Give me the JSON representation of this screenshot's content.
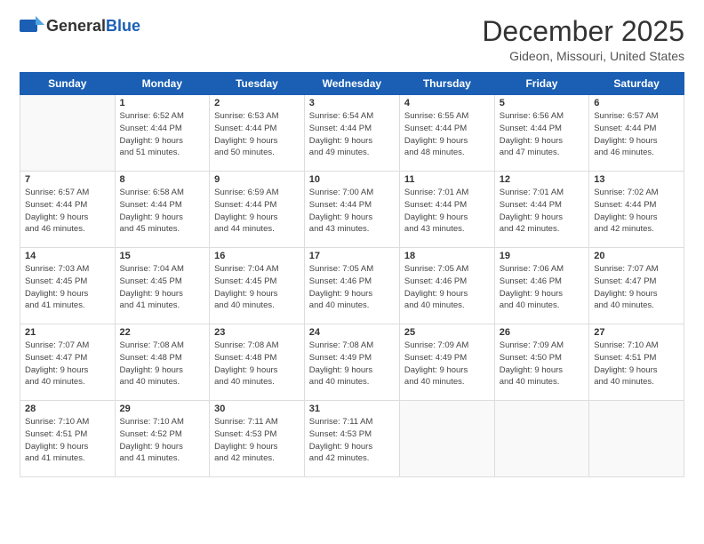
{
  "header": {
    "logo_general": "General",
    "logo_blue": "Blue",
    "title": "December 2025",
    "subtitle": "Gideon, Missouri, United States"
  },
  "weekdays": [
    "Sunday",
    "Monday",
    "Tuesday",
    "Wednesday",
    "Thursday",
    "Friday",
    "Saturday"
  ],
  "weeks": [
    [
      {
        "day": "",
        "info": ""
      },
      {
        "day": "1",
        "info": "Sunrise: 6:52 AM\nSunset: 4:44 PM\nDaylight: 9 hours\nand 51 minutes."
      },
      {
        "day": "2",
        "info": "Sunrise: 6:53 AM\nSunset: 4:44 PM\nDaylight: 9 hours\nand 50 minutes."
      },
      {
        "day": "3",
        "info": "Sunrise: 6:54 AM\nSunset: 4:44 PM\nDaylight: 9 hours\nand 49 minutes."
      },
      {
        "day": "4",
        "info": "Sunrise: 6:55 AM\nSunset: 4:44 PM\nDaylight: 9 hours\nand 48 minutes."
      },
      {
        "day": "5",
        "info": "Sunrise: 6:56 AM\nSunset: 4:44 PM\nDaylight: 9 hours\nand 47 minutes."
      },
      {
        "day": "6",
        "info": "Sunrise: 6:57 AM\nSunset: 4:44 PM\nDaylight: 9 hours\nand 46 minutes."
      }
    ],
    [
      {
        "day": "7",
        "info": "Sunrise: 6:57 AM\nSunset: 4:44 PM\nDaylight: 9 hours\nand 46 minutes."
      },
      {
        "day": "8",
        "info": "Sunrise: 6:58 AM\nSunset: 4:44 PM\nDaylight: 9 hours\nand 45 minutes."
      },
      {
        "day": "9",
        "info": "Sunrise: 6:59 AM\nSunset: 4:44 PM\nDaylight: 9 hours\nand 44 minutes."
      },
      {
        "day": "10",
        "info": "Sunrise: 7:00 AM\nSunset: 4:44 PM\nDaylight: 9 hours\nand 43 minutes."
      },
      {
        "day": "11",
        "info": "Sunrise: 7:01 AM\nSunset: 4:44 PM\nDaylight: 9 hours\nand 43 minutes."
      },
      {
        "day": "12",
        "info": "Sunrise: 7:01 AM\nSunset: 4:44 PM\nDaylight: 9 hours\nand 42 minutes."
      },
      {
        "day": "13",
        "info": "Sunrise: 7:02 AM\nSunset: 4:44 PM\nDaylight: 9 hours\nand 42 minutes."
      }
    ],
    [
      {
        "day": "14",
        "info": "Sunrise: 7:03 AM\nSunset: 4:45 PM\nDaylight: 9 hours\nand 41 minutes."
      },
      {
        "day": "15",
        "info": "Sunrise: 7:04 AM\nSunset: 4:45 PM\nDaylight: 9 hours\nand 41 minutes."
      },
      {
        "day": "16",
        "info": "Sunrise: 7:04 AM\nSunset: 4:45 PM\nDaylight: 9 hours\nand 40 minutes."
      },
      {
        "day": "17",
        "info": "Sunrise: 7:05 AM\nSunset: 4:46 PM\nDaylight: 9 hours\nand 40 minutes."
      },
      {
        "day": "18",
        "info": "Sunrise: 7:05 AM\nSunset: 4:46 PM\nDaylight: 9 hours\nand 40 minutes."
      },
      {
        "day": "19",
        "info": "Sunrise: 7:06 AM\nSunset: 4:46 PM\nDaylight: 9 hours\nand 40 minutes."
      },
      {
        "day": "20",
        "info": "Sunrise: 7:07 AM\nSunset: 4:47 PM\nDaylight: 9 hours\nand 40 minutes."
      }
    ],
    [
      {
        "day": "21",
        "info": "Sunrise: 7:07 AM\nSunset: 4:47 PM\nDaylight: 9 hours\nand 40 minutes."
      },
      {
        "day": "22",
        "info": "Sunrise: 7:08 AM\nSunset: 4:48 PM\nDaylight: 9 hours\nand 40 minutes."
      },
      {
        "day": "23",
        "info": "Sunrise: 7:08 AM\nSunset: 4:48 PM\nDaylight: 9 hours\nand 40 minutes."
      },
      {
        "day": "24",
        "info": "Sunrise: 7:08 AM\nSunset: 4:49 PM\nDaylight: 9 hours\nand 40 minutes."
      },
      {
        "day": "25",
        "info": "Sunrise: 7:09 AM\nSunset: 4:49 PM\nDaylight: 9 hours\nand 40 minutes."
      },
      {
        "day": "26",
        "info": "Sunrise: 7:09 AM\nSunset: 4:50 PM\nDaylight: 9 hours\nand 40 minutes."
      },
      {
        "day": "27",
        "info": "Sunrise: 7:10 AM\nSunset: 4:51 PM\nDaylight: 9 hours\nand 40 minutes."
      }
    ],
    [
      {
        "day": "28",
        "info": "Sunrise: 7:10 AM\nSunset: 4:51 PM\nDaylight: 9 hours\nand 41 minutes."
      },
      {
        "day": "29",
        "info": "Sunrise: 7:10 AM\nSunset: 4:52 PM\nDaylight: 9 hours\nand 41 minutes."
      },
      {
        "day": "30",
        "info": "Sunrise: 7:11 AM\nSunset: 4:53 PM\nDaylight: 9 hours\nand 42 minutes."
      },
      {
        "day": "31",
        "info": "Sunrise: 7:11 AM\nSunset: 4:53 PM\nDaylight: 9 hours\nand 42 minutes."
      },
      {
        "day": "",
        "info": ""
      },
      {
        "day": "",
        "info": ""
      },
      {
        "day": "",
        "info": ""
      }
    ]
  ]
}
